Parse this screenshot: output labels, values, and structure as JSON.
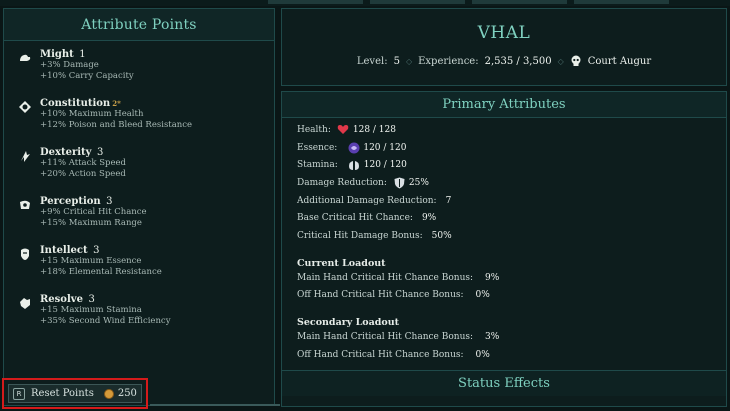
{
  "attributes_panel": {
    "title": "Attribute Points",
    "items": [
      {
        "name": "Might",
        "level": "1",
        "bonus": "",
        "lines": [
          "+3% Damage",
          "+10% Carry Capacity"
        ],
        "icon": "arm-icon"
      },
      {
        "name": "Constitution",
        "level": "",
        "bonus": "2*",
        "lines": [
          "+10% Maximum Health",
          "+12% Poison and Bleed Resistance"
        ],
        "icon": "heart-shield-icon"
      },
      {
        "name": "Dexterity",
        "level": "3",
        "bonus": "",
        "lines": [
          "+11% Attack Speed",
          "+20% Action Speed"
        ],
        "icon": "dash-icon"
      },
      {
        "name": "Perception",
        "level": "3",
        "bonus": "",
        "lines": [
          "+9% Critical Hit Chance",
          "+15% Maximum Range"
        ],
        "icon": "eye-icon"
      },
      {
        "name": "Intellect",
        "level": "3",
        "bonus": "",
        "lines": [
          "+15 Maximum Essence",
          "+18% Elemental Resistance"
        ],
        "icon": "head-icon"
      },
      {
        "name": "Resolve",
        "level": "3",
        "bonus": "",
        "lines": [
          "+15 Maximum Stamina",
          "+35% Second Wind Efficiency"
        ],
        "icon": "fist-icon"
      }
    ],
    "reset": {
      "key": "R",
      "label": "Reset Points",
      "cost": "250"
    }
  },
  "character": {
    "name": "VHAL",
    "level_label": "Level:",
    "level": "5",
    "experience_label": "Experience:",
    "experience": "2,535 / 3,500",
    "class_name": "Court Augur"
  },
  "primary": {
    "title": "Primary Attributes",
    "health_label": "Health:",
    "health": "128 / 128",
    "essence_label": "Essence:",
    "essence": "120 / 120",
    "stamina_label": "Stamina:",
    "stamina": "120 / 120",
    "dr_label": "Damage Reduction:",
    "dr": "25%",
    "add_dr_label": "Additional Damage Reduction:",
    "add_dr": "7",
    "crit_label": "Base Critical Hit Chance:",
    "crit": "9%",
    "crit_dmg_label": "Critical Hit Damage Bonus:",
    "crit_dmg": "50%",
    "current_loadout": {
      "title": "Current Loadout",
      "main_label": "Main Hand Critical Hit Chance Bonus:",
      "main": "9%",
      "off_label": "Off Hand Critical Hit Chance Bonus:",
      "off": "0%"
    },
    "secondary_loadout": {
      "title": "Secondary Loadout",
      "main_label": "Main Hand Critical Hit Chance Bonus:",
      "main": "3%",
      "off_label": "Off Hand Critical Hit Chance Bonus:",
      "off": "0%"
    },
    "status_effects": "Status Effects"
  },
  "colors": {
    "accent": "#7fd1c0",
    "highlight": "#d41b1b",
    "coin": "#d49a3a"
  }
}
